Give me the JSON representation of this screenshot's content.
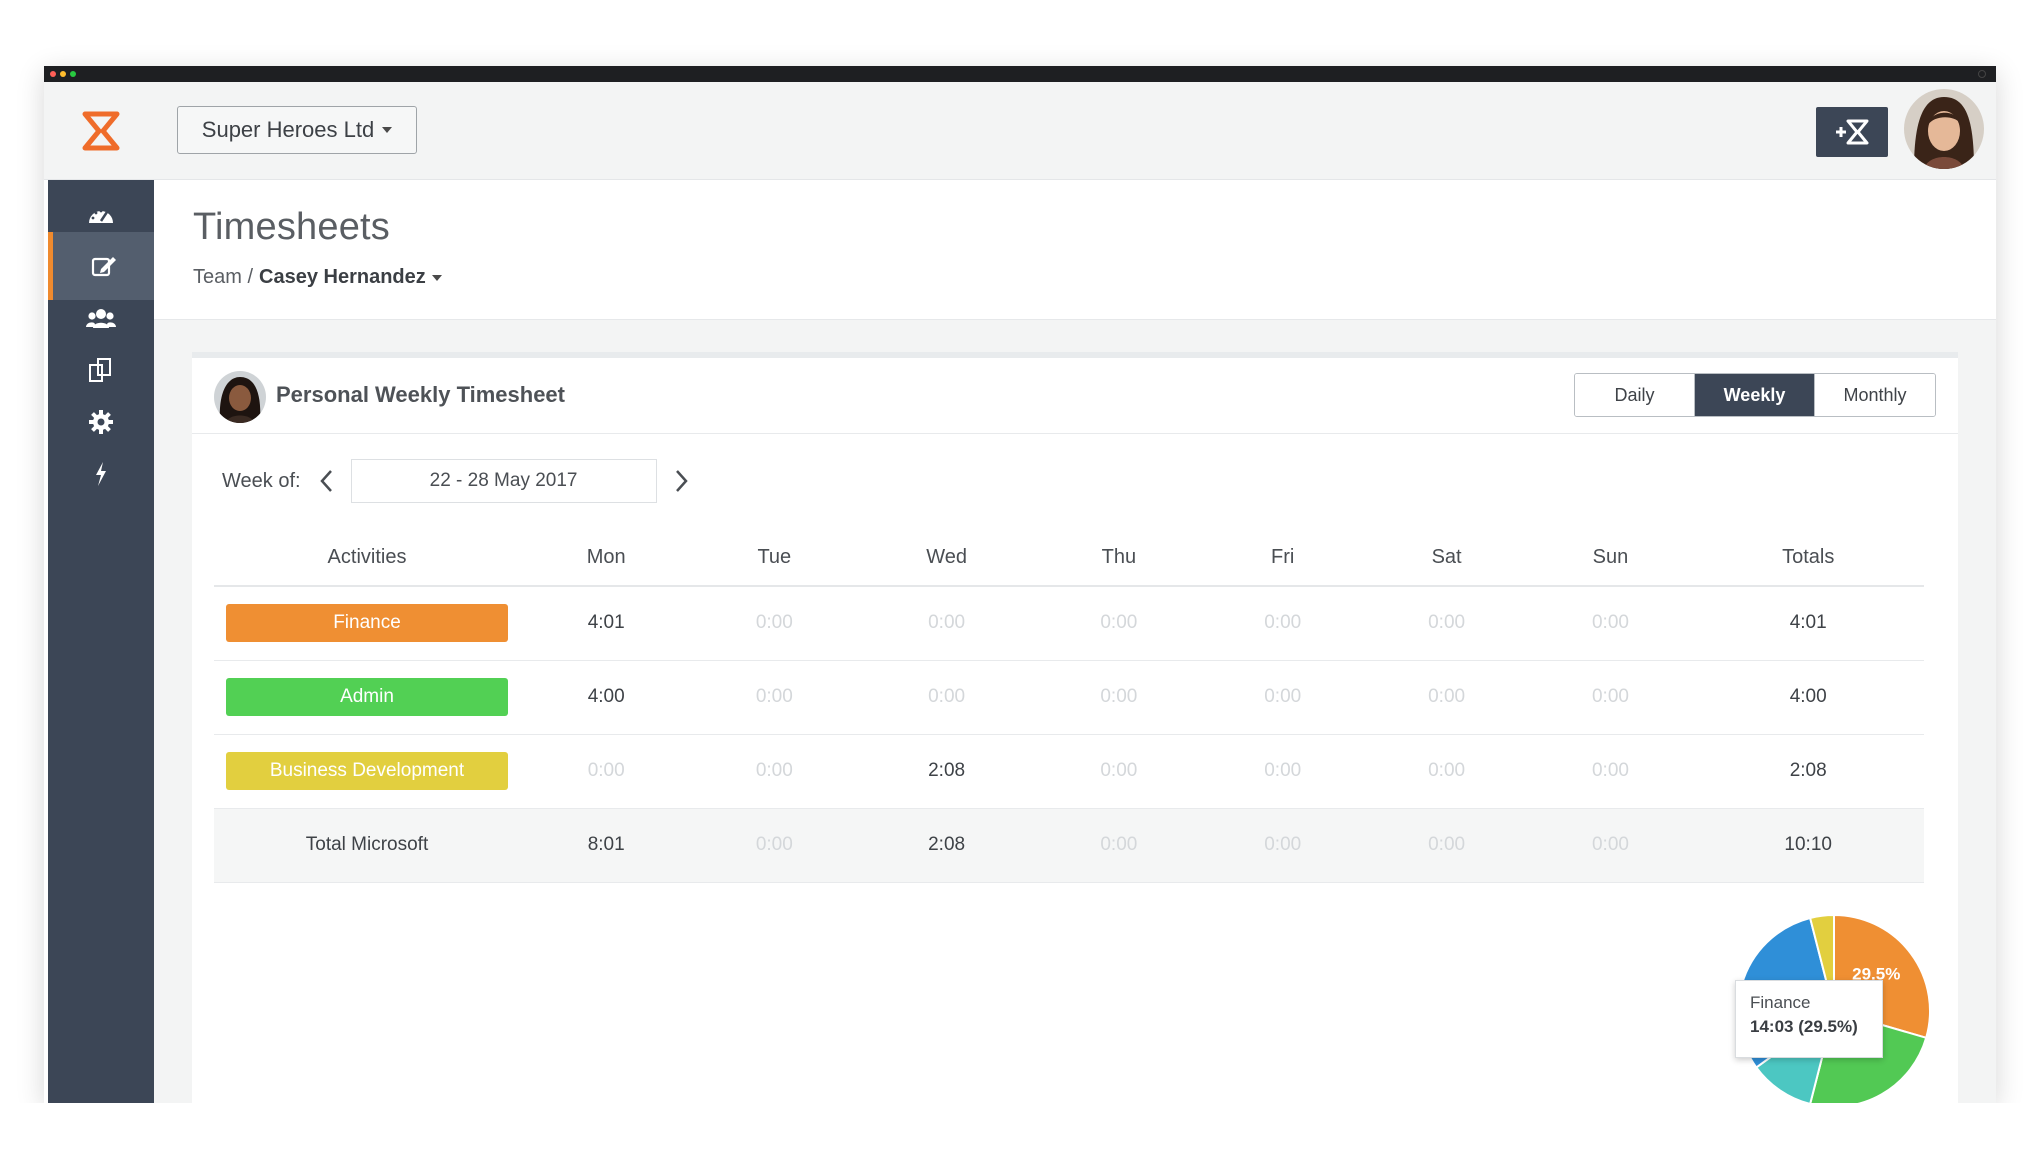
{
  "company": {
    "name": "Super Heroes Ltd"
  },
  "page": {
    "title": "Timesheets",
    "breadcrumb_team": "Team /",
    "breadcrumb_person": "Casey Hernandez"
  },
  "sidebar": {
    "items": [
      {
        "icon": "dashboard-icon",
        "active": false
      },
      {
        "icon": "timesheet-edit-icon",
        "active": true
      },
      {
        "icon": "team-icon",
        "active": false
      },
      {
        "icon": "projects-icon",
        "active": false
      },
      {
        "icon": "settings-icon",
        "active": false
      },
      {
        "icon": "integrations-icon",
        "active": false
      }
    ]
  },
  "card": {
    "title": "Personal Weekly Timesheet",
    "views": [
      "Daily",
      "Weekly",
      "Monthly"
    ],
    "active_view": "Weekly",
    "week_label": "Week of:",
    "week_value": "22 - 28 May 2017"
  },
  "table": {
    "headers": [
      "Activities",
      "Mon",
      "Tue",
      "Wed",
      "Thu",
      "Fri",
      "Sat",
      "Sun",
      "Totals"
    ],
    "rows": [
      {
        "activity": "Finance",
        "color": "#ef8f33",
        "cells": [
          "4:01",
          "0:00",
          "0:00",
          "0:00",
          "0:00",
          "0:00",
          "0:00"
        ],
        "total": "4:01"
      },
      {
        "activity": "Admin",
        "color": "#52d054",
        "cells": [
          "4:00",
          "0:00",
          "0:00",
          "0:00",
          "0:00",
          "0:00",
          "0:00"
        ],
        "total": "4:00"
      },
      {
        "activity": "Business Development",
        "color": "#e2cf3f",
        "cells": [
          "0:00",
          "0:00",
          "2:08",
          "0:00",
          "0:00",
          "0:00",
          "0:00"
        ],
        "total": "2:08"
      }
    ],
    "total_row": {
      "label": "Total Microsoft",
      "cells": [
        "8:01",
        "0:00",
        "2:08",
        "0:00",
        "0:00",
        "0:00",
        "0:00"
      ],
      "total": "10:10"
    }
  },
  "chart_data": {
    "type": "pie",
    "slices": [
      {
        "label": "Finance",
        "value": 29.5,
        "color": "#ef8f33"
      },
      {
        "label": "",
        "value": 24.5,
        "color": "#52c954"
      },
      {
        "label": "",
        "value": 11,
        "color": "#4cc7c2"
      },
      {
        "label": "",
        "value": 31,
        "color": "#2f8fd8"
      },
      {
        "label": "",
        "value": 4,
        "color": "#e2cf3f"
      }
    ],
    "visible_label": "29.5%"
  },
  "tooltip": {
    "label": "Finance",
    "value": "14:03 (29.5%)"
  },
  "colors": {
    "accent": "#ef8a2e",
    "sidebar": "#3c4656",
    "active_tab": "#3c4656"
  }
}
